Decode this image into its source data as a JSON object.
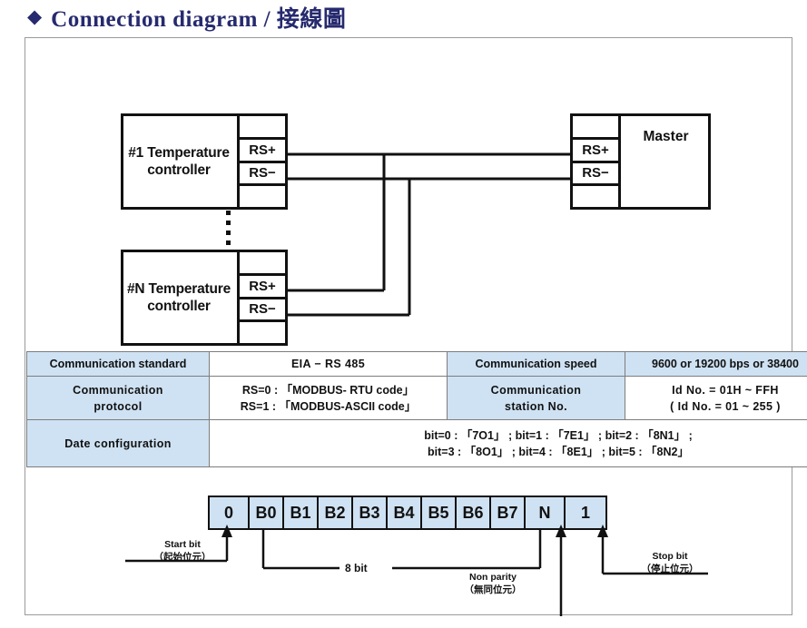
{
  "title": {
    "bullet": "◆",
    "text": "Connection diagram / 接線圖"
  },
  "diagram": {
    "controller_first": {
      "name": "#1 Temperature controller",
      "line1": "#1 Temperature",
      "line2": "controller",
      "terminals": [
        "",
        "RS+",
        "RS−",
        ""
      ]
    },
    "controller_last": {
      "name": "#N Temperature controller",
      "line1": "#N Temperature",
      "line2": "controller",
      "terminals": [
        "",
        "RS+",
        "RS−",
        ""
      ]
    },
    "master": {
      "label": "Master",
      "terminals": [
        "",
        "RS+",
        "RS−",
        ""
      ]
    },
    "ellipsis_dots": 4
  },
  "spec_table": {
    "rows": [
      {
        "label": "Communication standard",
        "value": "EIA − RS 485",
        "label2": "Communication speed",
        "value2": "9600 or 19200 bps or 38400"
      },
      {
        "label": "Communication protocol",
        "label_line1": "Communication",
        "label_line2": "protocol",
        "value_line1": "RS=0 : 「MODBUS- RTU code」",
        "value_line2": "RS=1 : 「MODBUS-ASCII code」",
        "label2_line1": "Communication",
        "label2_line2": "station No.",
        "value2_line1": "Id No. = 01H ~ FFH",
        "value2_line2": "( Id No. = 01 ~ 255 )"
      },
      {
        "label": "Date configuration",
        "value_line1": "bit=0 : 「7O1」 ; bit=1 : 「7E1」 ; bit=2 : 「8N1」 ;",
        "value_line2": "bit=3 : 「8O1」 ; bit=4 : 「8E1」 ; bit=5 : 「8N2」"
      }
    ]
  },
  "bit_frame": {
    "cells": [
      "0",
      "B0",
      "B1",
      "B2",
      "B3",
      "B4",
      "B5",
      "B6",
      "B7",
      "N",
      "1"
    ],
    "annotations": {
      "start_bit_en": "Start bit",
      "start_bit_cn": "（起始位元）",
      "eight_bit": "8 bit",
      "non_parity_en": "Non parity",
      "non_parity_cn": "（無同位元）",
      "stop_bit_en": "Stop bit",
      "stop_bit_cn": "（停止位元）"
    }
  },
  "colors": {
    "title": "#262a6e",
    "table_label_bg": "#cfe2f3",
    "frame_cell_bg": "#cfe2f3",
    "line": "#111111",
    "page_border": "#9a9a9a"
  }
}
